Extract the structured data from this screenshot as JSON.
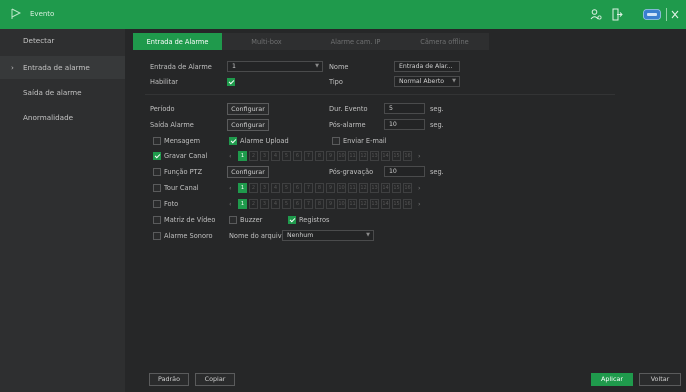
{
  "titlebar": {
    "title": "Evento",
    "accent": "#1f9a4c"
  },
  "sidebar": {
    "items": [
      {
        "label": "Detectar"
      },
      {
        "label": "Entrada de alarme"
      },
      {
        "label": "Saída de alarme"
      },
      {
        "label": "Anormalidade"
      }
    ]
  },
  "tabs": [
    {
      "label": "Entrada de Alarme"
    },
    {
      "label": "Multi-box"
    },
    {
      "label": "Alarme cam. IP"
    },
    {
      "label": "Câmera offline"
    }
  ],
  "form": {
    "entrada_label": "Entrada de Alarme",
    "entrada_value": "1",
    "nome_label": "Nome",
    "nome_value": "Entrada de Alar...",
    "habilitar_label": "Habilitar",
    "tipo_label": "Tipo",
    "tipo_value": "Normal Aberto",
    "periodo_label": "Período",
    "configurar_label": "Configurar",
    "dur_evento_label": "Dur. Evento",
    "dur_evento_value": "5",
    "seg": "seg.",
    "saida_alarme_label": "Saída Alarme",
    "pos_alarme_label": "Pós-alarme",
    "pos_alarme_value": "10",
    "mensagem_label": "Mensagem",
    "alarme_upload_label": "Alarme Upload",
    "enviar_email_label": "Enviar E-mail",
    "gravar_canal_label": "Gravar Canal",
    "funcao_ptz_label": "Função PTZ",
    "pos_gravacao_label": "Pós-gravação",
    "pos_gravacao_value": "10",
    "tour_canal_label": "Tour Canal",
    "foto_label": "Foto",
    "matriz_video_label": "Matriz de Vídeo",
    "buzzer_label": "Buzzer",
    "registros_label": "Registros",
    "alarme_sonoro_label": "Alarme Sonoro",
    "nome_arquivo_label": "Nome do arquivo",
    "nome_arquivo_value": "Nenhum",
    "channels": [
      "1",
      "2",
      "3",
      "4",
      "5",
      "6",
      "7",
      "8",
      "9",
      "10",
      "11",
      "12",
      "13",
      "14",
      "15",
      "16"
    ]
  },
  "footer": {
    "padrao": "Padrão",
    "copiar": "Copiar",
    "aplicar": "Aplicar",
    "voltar": "Voltar"
  }
}
